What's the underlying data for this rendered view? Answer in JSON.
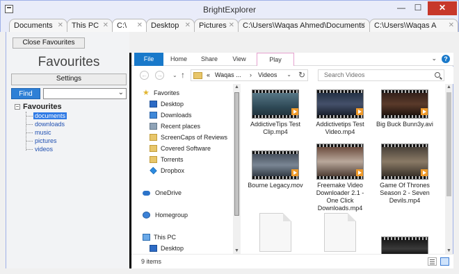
{
  "window": {
    "title": "BrightExplorer",
    "min": "—",
    "max": "☐",
    "close": "✕"
  },
  "tabs": [
    {
      "label": "Documents"
    },
    {
      "label": "This PC"
    },
    {
      "label": "C:\\"
    },
    {
      "label": "Desktop"
    },
    {
      "label": "Pictures"
    },
    {
      "label": "C:\\Users\\Waqas Ahmed\\Documents"
    },
    {
      "label": "C:\\Users\\Waqas A"
    }
  ],
  "tab_close": "✕",
  "left": {
    "close_favourites": "Close Favourites",
    "favourites_title": "Favourites",
    "settings": "Settings",
    "find": "Find",
    "find_chevron": "⌄",
    "tree_root": "Favourites",
    "tree_expander": "−",
    "tree_items": [
      "documents",
      "downloads",
      "music",
      "pictures",
      "videos"
    ]
  },
  "ribbon": {
    "tabs": [
      "File",
      "Home",
      "Share",
      "View",
      "Play"
    ],
    "chevron": "⌄",
    "help": "?"
  },
  "address": {
    "back": "←",
    "forward": "→",
    "recent": "⌄",
    "up": "↑",
    "prefix": "«",
    "crumb1": "Waqas ...",
    "sep": "›",
    "crumb2": "Videos",
    "drop": "⌄",
    "refresh": "↻",
    "search_placeholder": "Search Videos"
  },
  "nav": {
    "favorites": "Favorites",
    "items": [
      "Desktop",
      "Downloads",
      "Recent places",
      "ScreenCaps of Reviews",
      "Covered Software",
      "Torrents",
      "Dropbox"
    ],
    "onedrive": "OneDrive",
    "homegroup": "Homegroup",
    "thispc": "This PC",
    "pc_desktop": "Desktop",
    "star": "★"
  },
  "files": [
    {
      "name": "AddictiveTips Test Clip.mp4"
    },
    {
      "name": "Addictivetips Test Video.mp4"
    },
    {
      "name": "Big Buck Bunn3y.avi"
    },
    {
      "name": "Bourne Legacy.mov"
    },
    {
      "name": "Freemake Video Downloader 2.1 - One Click Downloads.mp4"
    },
    {
      "name": "Game Of Thrones Season 2 - Seven Devils.mp4"
    }
  ],
  "scroll": {
    "up": "▲",
    "down": "▼"
  },
  "status": {
    "count": "9 items"
  },
  "colors": {
    "accent": "#1979ca",
    "selection": "#2f7ae5",
    "find": "#2f80d6",
    "close": "#c7372b"
  }
}
